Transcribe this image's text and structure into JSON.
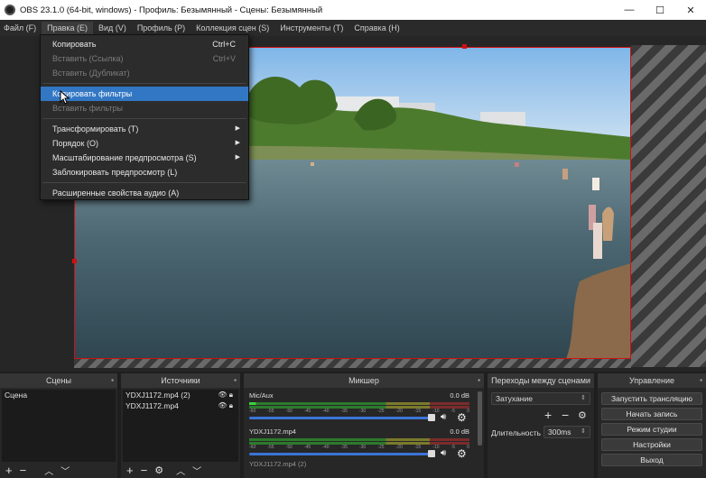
{
  "window": {
    "title": "OBS 23.1.0 (64-bit, windows) - Профиль: Безымянный - Сцены: Безымянный",
    "minimize": "—",
    "maximize": "☐",
    "close": "✕"
  },
  "menubar": [
    "Файл (F)",
    "Правка (E)",
    "Вид (V)",
    "Профиль (P)",
    "Коллекция сцен (S)",
    "Инструменты (T)",
    "Справка (H)"
  ],
  "edit_menu": {
    "copy": {
      "label": "Копировать",
      "shortcut": "Ctrl+C"
    },
    "paste_ref": {
      "label": "Вставить (Ссылка)",
      "shortcut": "Ctrl+V"
    },
    "paste_dup": {
      "label": "Вставить (Дубликат)"
    },
    "copy_filters": {
      "label": "Копировать фильтры"
    },
    "paste_filters": {
      "label": "Вставить фильтры"
    },
    "transform": {
      "label": "Трансформировать (T)"
    },
    "order": {
      "label": "Порядок (O)"
    },
    "preview_scale": {
      "label": "Масштабирование предпросмотра (S)"
    },
    "lock_preview": {
      "label": "Заблокировать предпросмотр (L)"
    },
    "adv_audio": {
      "label": "Расширенные свойства аудио (A)"
    }
  },
  "docks": {
    "scenes": {
      "title": "Сцены",
      "items": [
        "Сцена"
      ]
    },
    "sources": {
      "title": "Источники",
      "items": [
        "YDXJ1172.mp4 (2)",
        "YDXJ1172.mp4"
      ]
    },
    "mixer": {
      "title": "Микшер",
      "ticks": [
        "-60",
        "-55",
        "-50",
        "-45",
        "-40",
        "-35",
        "-30",
        "-25",
        "-20",
        "-15",
        "-10",
        "-5",
        "0"
      ],
      "tracks": [
        {
          "name": "Mic/Aux",
          "db": "0.0 dB",
          "level": 0.03,
          "volume": 1.0
        },
        {
          "name": "YDXJ1172.mp4",
          "db": "0.0 dB",
          "level": 0.0,
          "volume": 1.0
        }
      ],
      "partial_track": "YDXJ1172.mp4 (2)"
    },
    "transitions": {
      "title": "Переходы между сценами",
      "selected": "Затухание",
      "duration_label": "Длительность",
      "duration_value": "300ms"
    },
    "controls": {
      "title": "Управление",
      "buttons": [
        "Запустить трансляцию",
        "Начать запись",
        "Режим студии",
        "Настройки",
        "Выход"
      ]
    }
  },
  "colors": {
    "highlight": "#3277c4",
    "selection_border": "#d01010",
    "volume": "#3b74d6"
  }
}
